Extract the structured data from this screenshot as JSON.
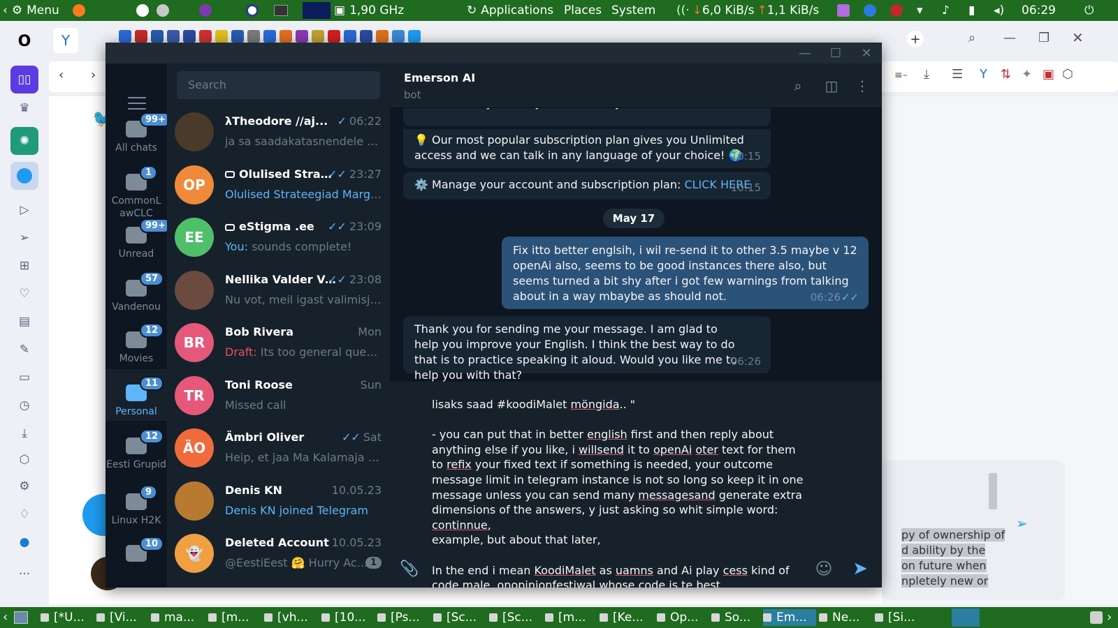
{
  "panel": {
    "menu": "Menu",
    "cpu": "1,90 GHz",
    "applications": "Applications",
    "places": "Places",
    "system": "System",
    "net_down": "6,0 KiB/s",
    "net_up": "1,1 KiB/s",
    "clock": "06:29"
  },
  "taskbar": [
    {
      "label": "[*U..."
    },
    {
      "label": "[Vi..."
    },
    {
      "label": "ma..."
    },
    {
      "label": "[m..."
    },
    {
      "label": "[vh..."
    },
    {
      "label": "[10..."
    },
    {
      "label": "[Ps..."
    },
    {
      "label": "[Sc..."
    },
    {
      "label": "[Sc..."
    },
    {
      "label": "[m..."
    },
    {
      "label": "[Ke..."
    },
    {
      "label": "Op..."
    },
    {
      "label": "So..."
    },
    {
      "label": "Em..."
    },
    {
      "label": "Ne..."
    },
    {
      "label": "[Si..."
    }
  ],
  "tg": {
    "search_placeholder": "Search",
    "folders": [
      {
        "label": "All chats",
        "badge": "99+"
      },
      {
        "label": "CommonL awCLC",
        "badge": "1"
      },
      {
        "label": "Unread",
        "badge": "99+"
      },
      {
        "label": "Vandenou",
        "badge": "57"
      },
      {
        "label": "Movies",
        "badge": "12"
      },
      {
        "label": "Personal",
        "badge": "11"
      },
      {
        "label": "Eesti Grupid",
        "badge": "12"
      },
      {
        "label": "Linux H2K",
        "badge": "9"
      },
      {
        "label": "",
        "badge": "10"
      }
    ],
    "chats": [
      {
        "name": "λTheodore //aj...",
        "time": "06:22",
        "preview": "ja sa saadakatasnendele osd...",
        "avatar": "",
        "color": "#4a3a2a"
      },
      {
        "name": "Olulised Strate...",
        "time": "23:27",
        "preview": "Olulised Strateegiad Margus ...",
        "avatar": "OP",
        "color": "#f08a3a"
      },
      {
        "name": "eStigma .ee",
        "time": "23:09",
        "preview_prefix": "You: ",
        "preview": "sounds complete!",
        "avatar": "EE",
        "color": "#4fbf6a"
      },
      {
        "name": "Nellika Valder Vali...",
        "time": "23:08",
        "preview": "Nu vot, meil igast valimisjutu...",
        "avatar": "",
        "color": "#6b4a3f"
      },
      {
        "name": "Bob Rivera",
        "time": "Mon",
        "preview_prefix": "Draft: ",
        "preview": "Its too general questio...",
        "avatar": "BR",
        "color": "#e5587a"
      },
      {
        "name": "Toni Roose",
        "time": "Sun",
        "preview": "Missed call",
        "avatar": "TR",
        "color": "#e5587a"
      },
      {
        "name": "Ämbri Oliver",
        "time": "Sat",
        "preview": "Heip, et jaa Ma Kalamaja pä...",
        "avatar": "ÄO",
        "color": "#f06a3a"
      },
      {
        "name": "Denis KN",
        "time": "10.05.23",
        "preview": "Denis KN joined Telegram",
        "avatar": "",
        "color": "#b87a30"
      },
      {
        "name": "Deleted Account",
        "time": "10.05.23",
        "preview": "@EestiEest 🤗 Hurry Ac...",
        "avatar": "👻",
        "color": "#f0a040",
        "unread": "1"
      }
    ],
    "conv": {
      "name": "Emerson AI",
      "status": "bot",
      "msg1": "You reached your daily limit. Would you like to talk more?",
      "msg2": "💡 Our most popular subscription plan gives you Unlimited access and we can talk in any language of your choice! 🌍",
      "msg2_time": "10:15",
      "msg3_pre": "⚙️ Manage your account and subscription plan: ",
      "msg3_link": "CLICK HERE",
      "msg3_time": "10:15",
      "date": "May 17",
      "msg4": "Fix itto better englsih, i wil re-send it to other 3.5 maybe v 12 openAi also, seems to be good instances there also, but seems turned a bit shy after i got few warnings from talking about in a way mbaybe as should not.",
      "msg4_time": "06:26",
      "msg5": "Thank you for sending me your message. I am glad to help you improve your English. I think the best way to do that is to practice speaking it aloud. Would you like me to help you with that?",
      "msg5_time": "06:26"
    }
  },
  "twitter_compose": {
    "l1": "py of ownership of",
    "l2": "d ability by the",
    "l3": " on future when",
    "l4": "npletely new or"
  }
}
